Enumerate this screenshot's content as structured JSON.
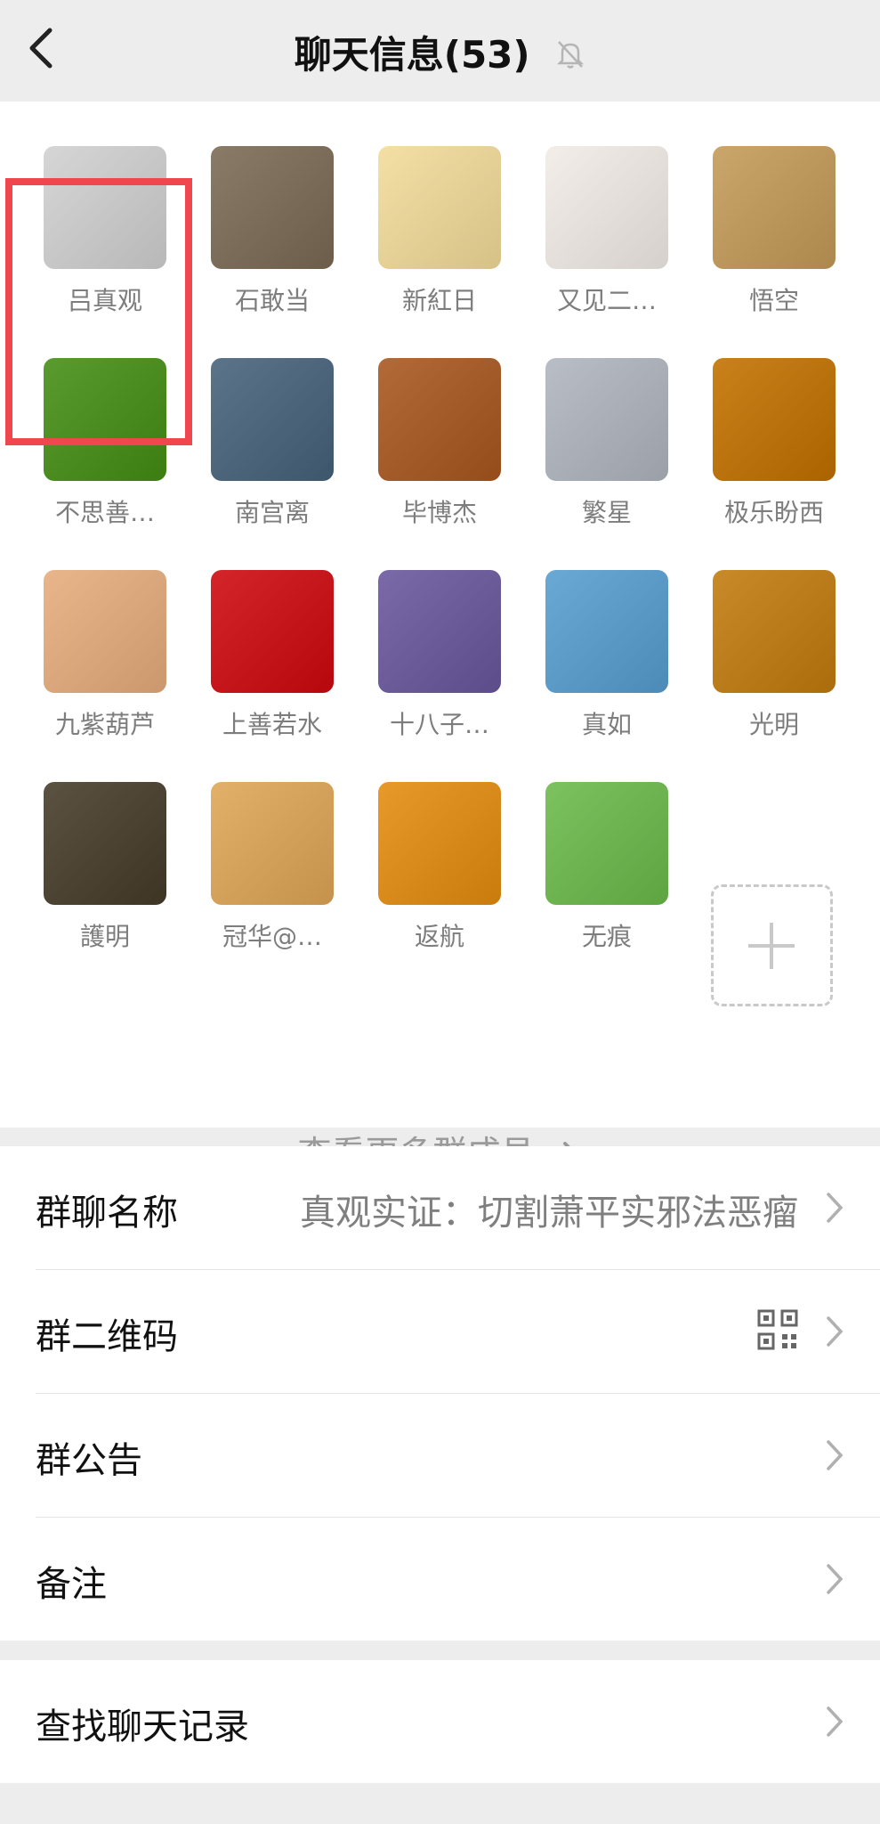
{
  "header": {
    "title": "聊天信息(53)",
    "back_icon": "chevron-left-icon",
    "mute_icon": "bell-off-icon"
  },
  "members": [
    {
      "name": "吕真观",
      "avatar": "cartoon-old-man",
      "color": "#d6d6d6"
    },
    {
      "name": "石敢当",
      "avatar": "stone-tablet",
      "color": "#8a7b68"
    },
    {
      "name": "新紅日",
      "avatar": "dragon-calligraphy",
      "color": "#f4dfa5"
    },
    {
      "name": "又见二…",
      "avatar": "cartoon-child",
      "color": "#f3eee9"
    },
    {
      "name": "悟空",
      "avatar": "baby-monk",
      "color": "#cba66b"
    },
    {
      "name": "不思善…",
      "avatar": "lotus-pond",
      "color": "#5a9b2f"
    },
    {
      "name": "南宫离",
      "avatar": "person-by-sea",
      "color": "#5b7489"
    },
    {
      "name": "毕博杰",
      "avatar": "great-wall",
      "color": "#b26a38"
    },
    {
      "name": "繁星",
      "avatar": "warrior-painting",
      "color": "#b9bec6"
    },
    {
      "name": "极乐盼西",
      "avatar": "golden-buddha",
      "color": "#c9811b"
    },
    {
      "name": "九紫葫芦",
      "avatar": "gourd-art",
      "color": "#e9b58a"
    },
    {
      "name": "上善若水",
      "avatar": "flag-art",
      "color": "#d4262a"
    },
    {
      "name": "十八子…",
      "avatar": "lavender-basket",
      "color": "#7a6aa8"
    },
    {
      "name": "真如",
      "avatar": "monk-on-lion",
      "color": "#6aa8d6"
    },
    {
      "name": "光明",
      "avatar": "spice-market",
      "color": "#c98a2a"
    },
    {
      "name": "護明",
      "avatar": "buddha-statue",
      "color": "#5b5242"
    },
    {
      "name": "冠华@…",
      "avatar": "buddha-sunset",
      "color": "#e3b06a"
    },
    {
      "name": "返航",
      "avatar": "sunset-field",
      "color": "#e79a2a"
    },
    {
      "name": "无痕",
      "avatar": "crystal-ball-green",
      "color": "#7cc25f"
    }
  ],
  "add_member_icon": "plus-icon",
  "view_more": {
    "label": "查看更多群成员",
    "icon": "chevron-right-icon"
  },
  "settings": [
    {
      "label": "群聊名称",
      "value": "真观实证：切割萧平实邪法恶瘤"
    },
    {
      "label": "群二维码",
      "value": "",
      "icon": "qr-code-icon"
    },
    {
      "label": "群公告",
      "value": ""
    },
    {
      "label": "备注",
      "value": ""
    }
  ],
  "search_history": {
    "label": "查找聊天记录"
  },
  "colors": {
    "background": "#ededed",
    "panel": "#ffffff",
    "highlight": "#f0474f",
    "label": "#111111",
    "muted": "#7d7d7d"
  }
}
